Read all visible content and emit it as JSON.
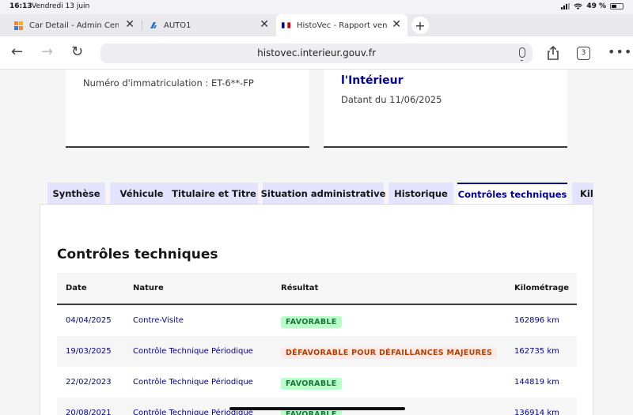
{
  "status_bar": {
    "time": "16:13",
    "date": "Vendredi 13 juin",
    "battery": "49 %"
  },
  "tabs": [
    {
      "title": "Car Detail - Admin Center",
      "favicon": "orange-squares-icon"
    },
    {
      "title": "AUTO1",
      "favicon": "auto1-logo-icon"
    },
    {
      "title": "HistoVec - Rapport vendeur",
      "favicon": "french-flag-icon"
    }
  ],
  "browser": {
    "url": "histovec.interieur.gouv.fr",
    "tab_count": "3"
  },
  "cards": {
    "left_text": "Numéro d'immatriculation : ET-6**-FP",
    "right_title": "l'Intérieur",
    "right_text": "Datant du 11/06/2025"
  },
  "page_tabs": [
    "Synthèse",
    "Véhicule",
    "Titulaire et Titre",
    "Situation administrative",
    "Historique",
    "Contrôles techniques",
    "Kilométrage"
  ],
  "section_title": "Contrôles techniques",
  "table": {
    "headers": [
      "Date",
      "Nature",
      "Résultat",
      "Kilométrage"
    ],
    "rows": [
      {
        "date": "04/04/2025",
        "nature": "Contre-Visite",
        "result": "FAVORABLE",
        "status": "ok",
        "km": "162896 km"
      },
      {
        "date": "19/03/2025",
        "nature": "Contrôle Technique Périodique",
        "result": "DÉFAVORABLE POUR DÉFAILLANCES MAJEURES",
        "status": "ko",
        "km": "162735 km"
      },
      {
        "date": "22/02/2023",
        "nature": "Contrôle Technique Périodique",
        "result": "FAVORABLE",
        "status": "ok",
        "km": "144819 km"
      },
      {
        "date": "20/08/2021",
        "nature": "Contrôle Technique Périodique",
        "result": "FAVORABLE",
        "status": "ok",
        "km": "136914 km"
      }
    ]
  },
  "colors": {
    "accent": "#000091",
    "tab_bg": "#e3e3fd",
    "ok_bg": "#b8fec9",
    "ok_fg": "#18753c",
    "ko_bg": "#ffe9e6",
    "ko_fg": "#b34000"
  }
}
